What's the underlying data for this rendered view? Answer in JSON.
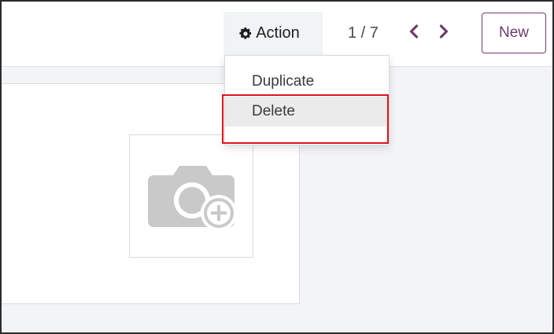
{
  "control_bar": {
    "action_label": "Action",
    "action_icon": "gear-icon",
    "pager_value": "1 / 7",
    "prev_icon": "chevron-left-icon",
    "next_icon": "chevron-right-icon",
    "new_label": "New"
  },
  "dropdown": {
    "items": [
      {
        "label": "Duplicate"
      },
      {
        "label": "Delete"
      }
    ],
    "highlighted": "Delete"
  },
  "form": {
    "image_icon": "camera-add-icon"
  },
  "colors": {
    "accent": "#6e3d6a",
    "highlight": "#e0131b",
    "content_bg": "#f3f4f6",
    "active_item_bg": "#ebebeb"
  }
}
